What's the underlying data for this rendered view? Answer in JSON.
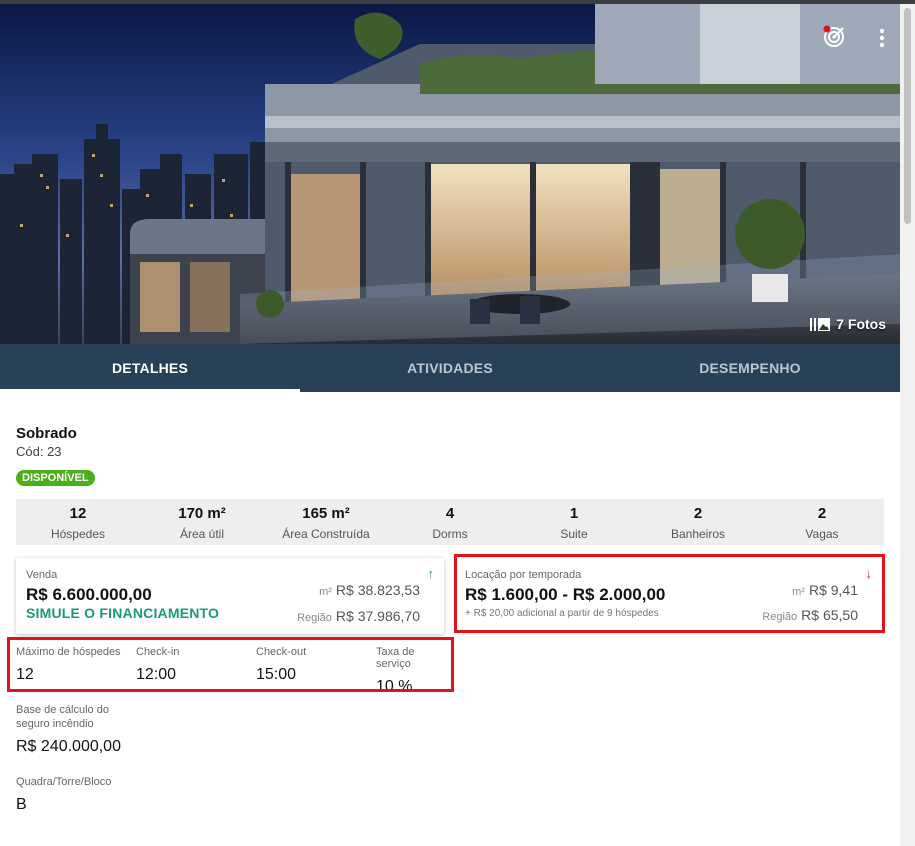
{
  "hero": {
    "photo_count_label": "7 Fotos",
    "target_icon": "target-icon",
    "more_icon": "more-vertical-icon",
    "photos_icon": "photos-icon"
  },
  "tabs": [
    {
      "label": "DETALHES",
      "active": true
    },
    {
      "label": "ATIVIDADES",
      "active": false
    },
    {
      "label": "DESEMPENHO",
      "active": false
    }
  ],
  "property": {
    "type": "Sobrado",
    "code": "Cód: 23",
    "status": "DISPONÍVEL",
    "status_color": "#4caf1a"
  },
  "stats": [
    {
      "value": "12",
      "label": "Hóspedes"
    },
    {
      "value": "170 m²",
      "label": "Área útil"
    },
    {
      "value": "165 m²",
      "label": "Área Construída"
    },
    {
      "value": "4",
      "label": "Dorms"
    },
    {
      "value": "1",
      "label": "Suite"
    },
    {
      "value": "2",
      "label": "Banheiros"
    },
    {
      "value": "2",
      "label": "Vagas"
    }
  ],
  "sale": {
    "label": "Venda",
    "price": "R$ 6.600.000,00",
    "cta": "SIMULE O FINANCIAMENTO",
    "m2_key": "m²",
    "m2_value": "R$ 38.823,53",
    "region_key": "Região",
    "region_value": "R$ 37.986,70",
    "trend": "↑"
  },
  "rent": {
    "label": "Locação por temporada",
    "price": "R$ 1.600,00 - R$ 2.000,00",
    "note": "+ R$ 20,00 adicional a partir de 9 hóspedes",
    "m2_key": "m²",
    "m2_value": "R$ 9,41",
    "region_key": "Região",
    "region_value": "R$ 65,50",
    "trend": "↓"
  },
  "rules": [
    {
      "label": "Máximo de hóspedes",
      "value": "12"
    },
    {
      "label": "Check-in",
      "value": "12:00"
    },
    {
      "label": "Check-out",
      "value": "15:00"
    },
    {
      "label": "Taxa de serviço",
      "value": "10 %"
    }
  ],
  "insurance": {
    "label": "Base de cálculo do seguro incêndio",
    "value": "R$ 240.000,00"
  },
  "block": {
    "label": "Quadra/Torre/Bloco",
    "value": "B"
  },
  "colors": {
    "tab_bar": "#284156",
    "highlight_box": "#e0131a",
    "cta": "#1b9a7a",
    "trend_up": "#2e9a2e",
    "trend_down": "#d21a1a"
  }
}
